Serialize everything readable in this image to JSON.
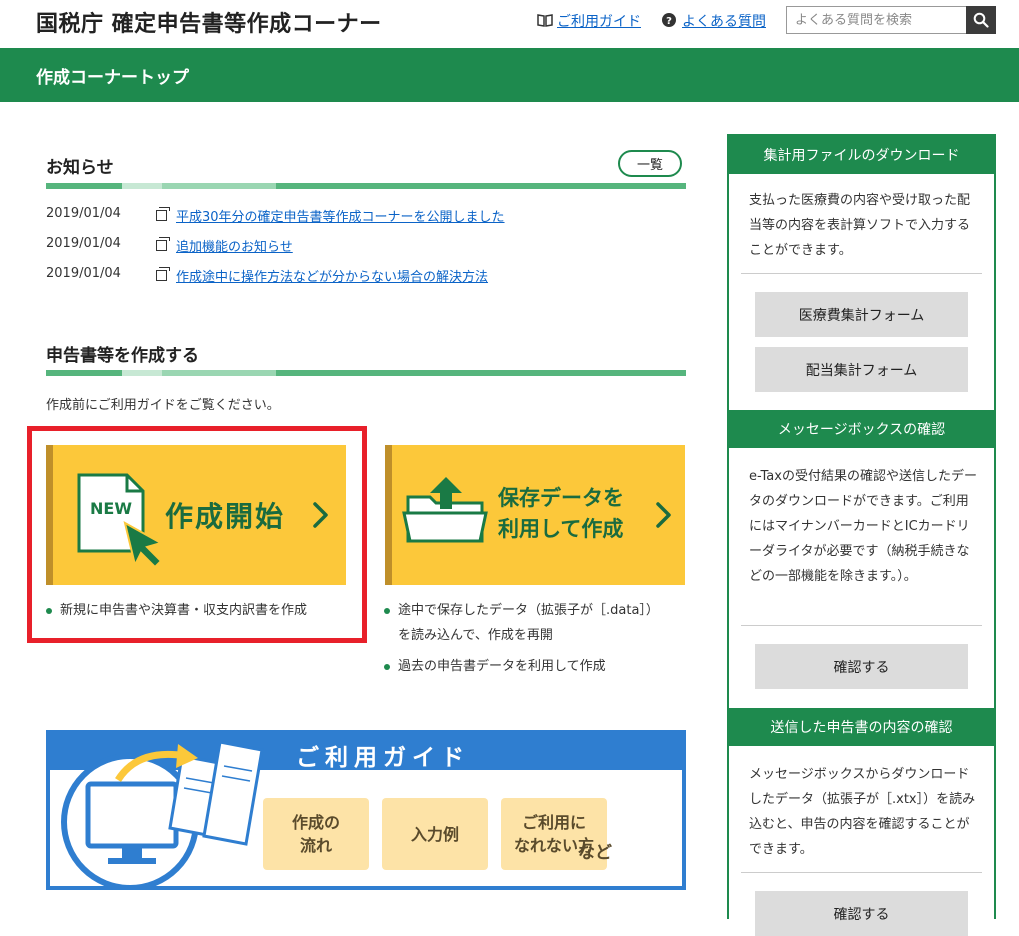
{
  "header": {
    "site_title": "国税庁 確定申告書等作成コーナー",
    "guide_link": "ご利用ガイド",
    "faq_link": "よくある質問",
    "search_placeholder": "よくある質問を検索"
  },
  "nav": {
    "title": "作成コーナートップ"
  },
  "news": {
    "heading": "お知らせ",
    "list_button": "一覧",
    "items": [
      {
        "date": "2019/01/04",
        "title": "平成30年分の確定申告書等作成コーナーを公開しました"
      },
      {
        "date": "2019/01/04",
        "title": "追加機能のお知らせ"
      },
      {
        "date": "2019/01/04",
        "title": "作成途中に操作方法などが分からない場合の解決方法"
      }
    ]
  },
  "create": {
    "heading": "申告書等を作成する",
    "note": "作成前にご利用ガイドをご覧ください。",
    "new_button": {
      "badge": "NEW",
      "label": "作成開始"
    },
    "new_desc": "新規に申告書や決算書・収支内訳書を作成",
    "saved_button": {
      "label_line1": "保存データを",
      "label_line2": "利用して作成"
    },
    "saved_desc_1_line1": "途中で保存したデータ（拡張子が［.data］）",
    "saved_desc_1_line2": "を読み込んで、作成を再開",
    "saved_desc_2": "過去の申告書データを利用して作成"
  },
  "guide_banner": {
    "title": "ご利用ガイド",
    "pills": [
      "作成の\n流れ",
      "入力例",
      "ご利用に\nなれない方"
    ],
    "etc": "など"
  },
  "sidebar": {
    "download": {
      "heading": "集計用ファイルのダウンロード",
      "text": "支払った医療費の内容や受け取った配当等の内容を表計算ソフトで入力することができます。",
      "buttons": [
        "医療費集計フォーム",
        "配当集計フォーム"
      ]
    },
    "messagebox": {
      "heading": "メッセージボックスの確認",
      "text": "e-Taxの受付結果の確認や送信したデータのダウンロードができます。ご利用にはマイナンバーカードとICカードリーダライタが必要です（納税手続きなどの一部機能を除きます。）。",
      "button": "確認する"
    },
    "sent": {
      "heading": "送信した申告書の内容の確認",
      "text": "メッセージボックスからダウンロードしたデータ（拡張子が［.xtx］）を読み込むと、申告の内容を確認することができます。",
      "button": "確認する"
    }
  },
  "colors": {
    "brand_green": "#1e8a4e",
    "button_yellow": "#fcc83a",
    "highlight_red": "#e8202a",
    "guide_blue": "#2f7ed0"
  }
}
